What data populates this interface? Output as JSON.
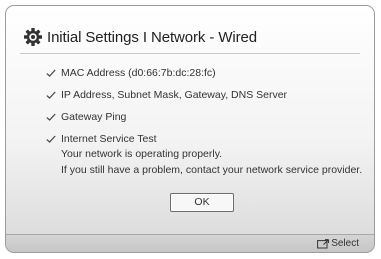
{
  "dialog": {
    "title": "Initial Settings I Network - Wired",
    "title_icon": "gear-icon"
  },
  "checks": [
    {
      "label": "MAC Address (d0:66:7b:dc:28:fc)",
      "status": "passed"
    },
    {
      "label": "IP Address, Subnet Mask, Gateway, DNS Server",
      "status": "passed"
    },
    {
      "label": "Gateway Ping",
      "status": "passed"
    },
    {
      "label": "Internet Service Test",
      "status": "passed"
    }
  ],
  "message": {
    "line1": "Your network is operating properly.",
    "line2": "If you still have a problem, contact your network service provider."
  },
  "ok_button": {
    "label": "OK"
  },
  "footer": {
    "select_label": "Select",
    "select_icon": "enter-icon"
  }
}
